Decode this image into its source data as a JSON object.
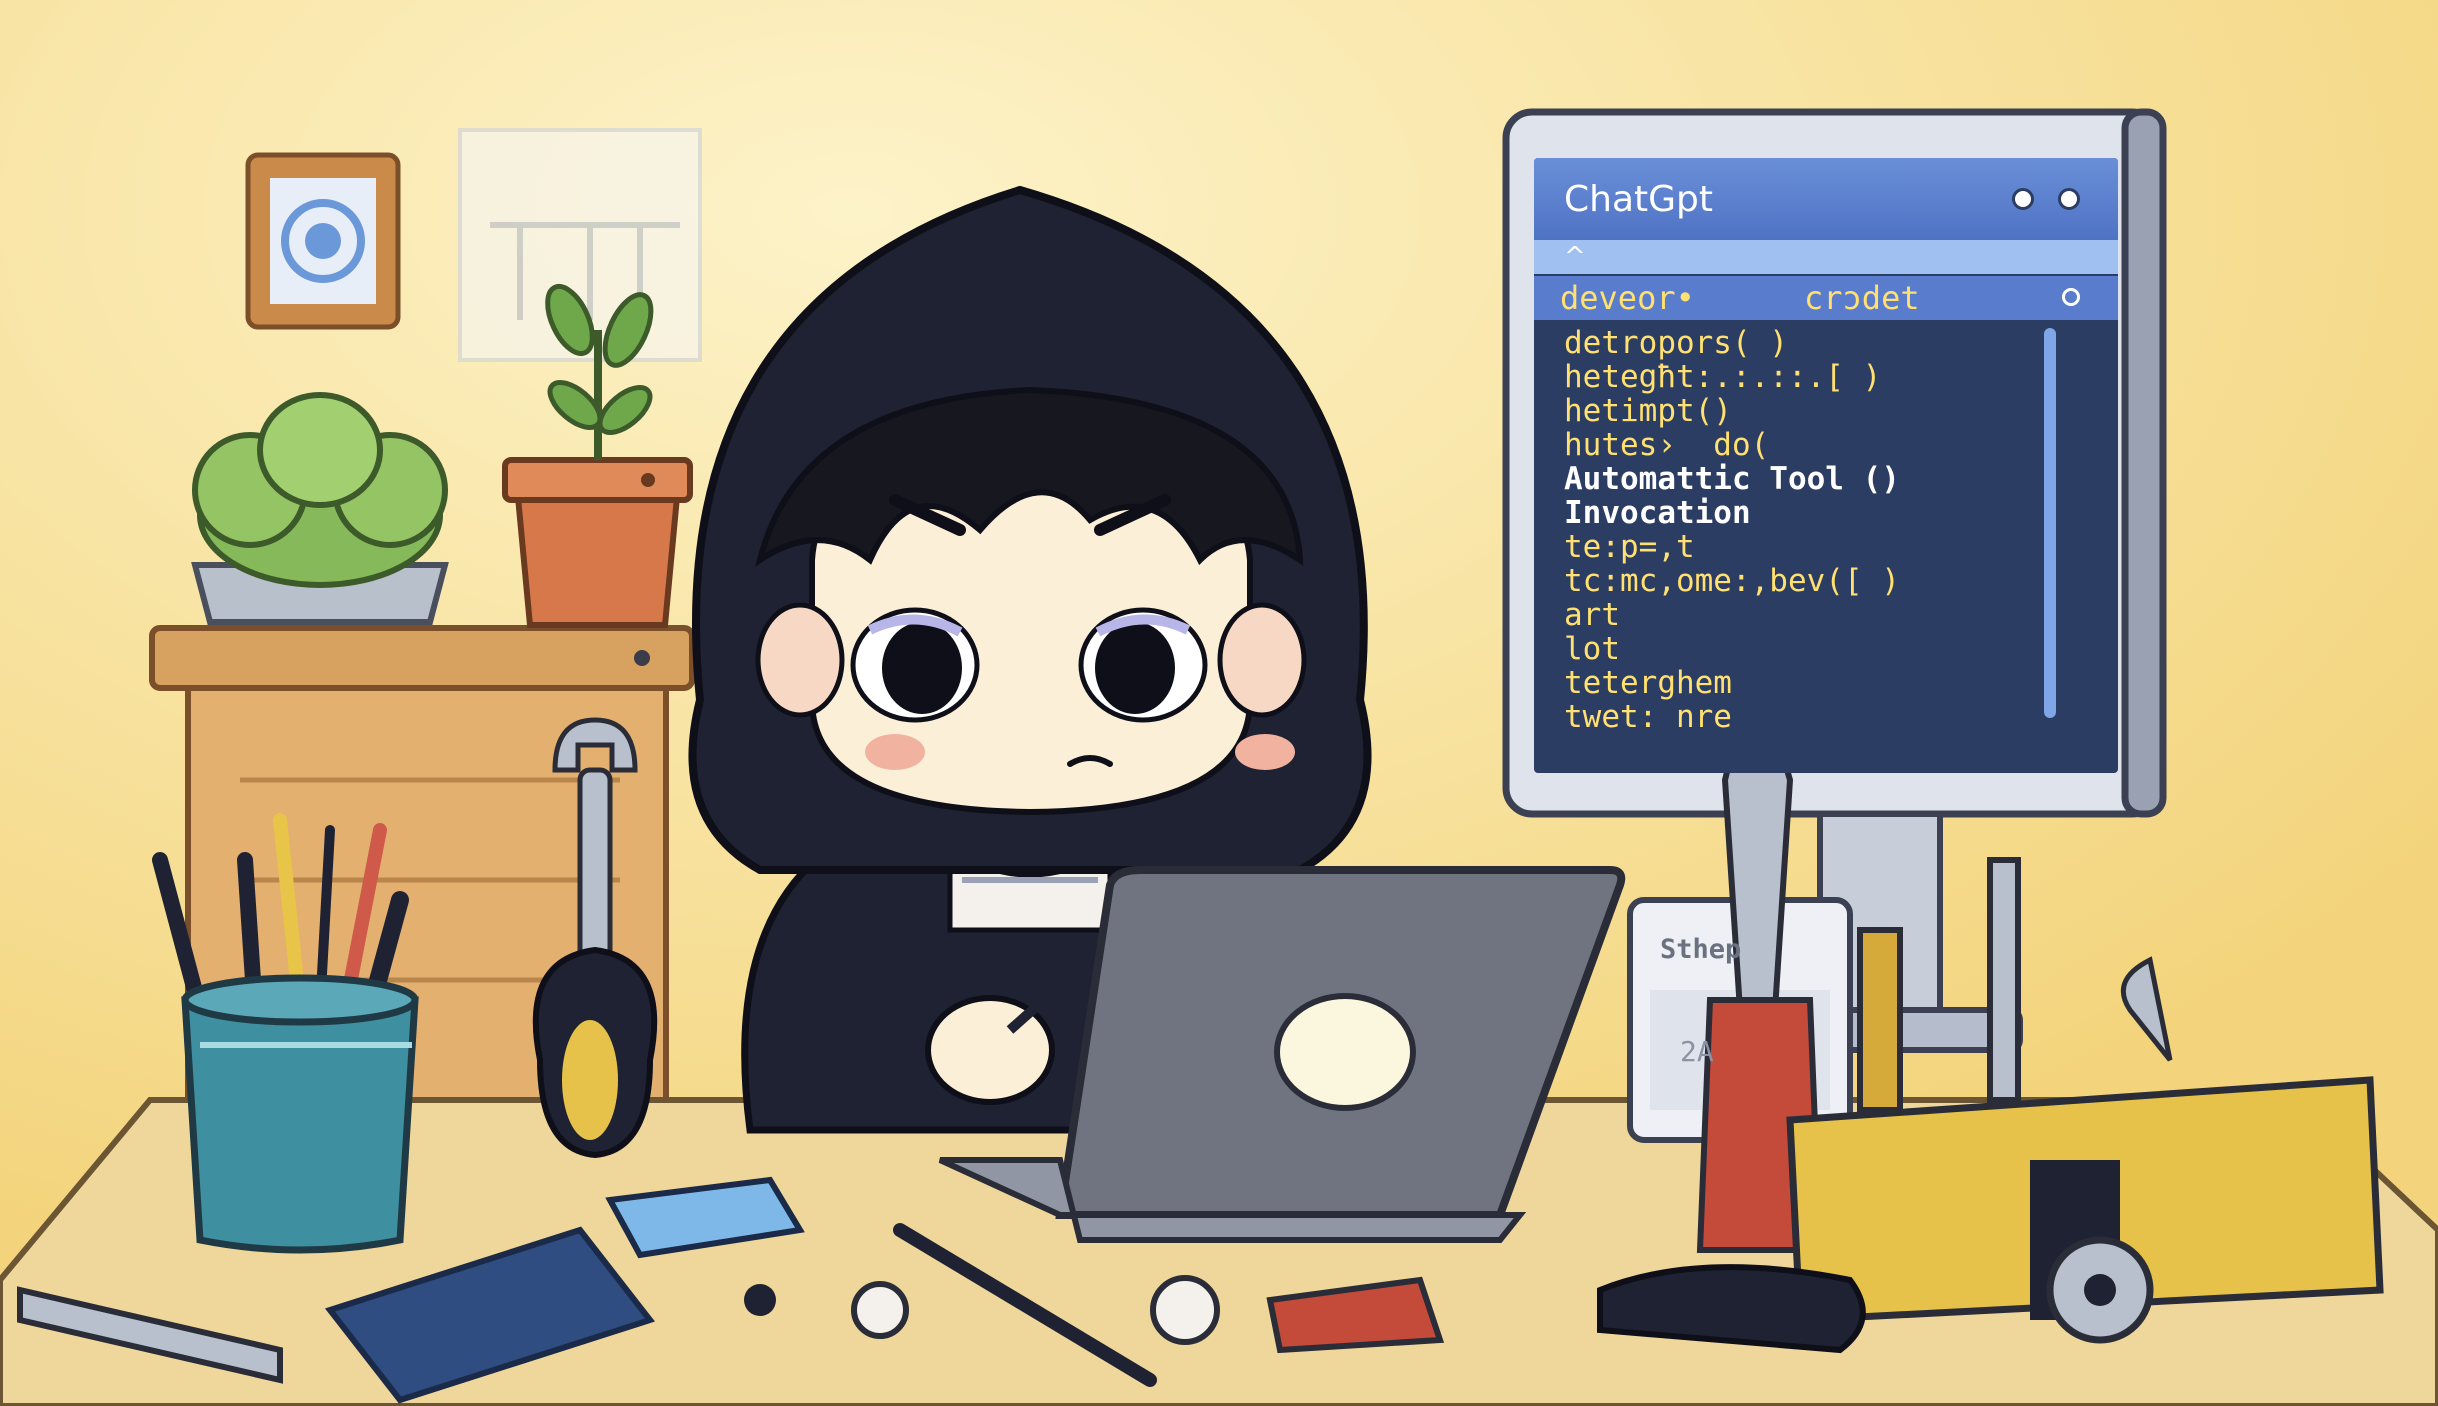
{
  "monitor": {
    "app_title": "ChatGpt",
    "bar2_text": "^",
    "bar3_left": "deveor•",
    "bar3_right": "crɔdet",
    "code_lines": [
      "detropors( )",
      "hetegħt:.:.::.[ )",
      "hetimpt()",
      "hutes›  do(",
      "Automattic Tool ()",
      "Invocation",
      "te:p=,t",
      "tc:mc,ome:,bev([ )",
      "art",
      "lot",
      "teterghem",
      "twet: nre"
    ]
  },
  "back_screen": {
    "label": "Sthep",
    "number": "2A"
  },
  "colors": {
    "wall": "#f6dd8a",
    "desk": "#efd69a",
    "hoodie": "#1f2232",
    "laptop": "#6f7480",
    "screen_bg": "#2c3d63",
    "screen_title": "#5a7ccc",
    "code_text": "#ffe070"
  }
}
